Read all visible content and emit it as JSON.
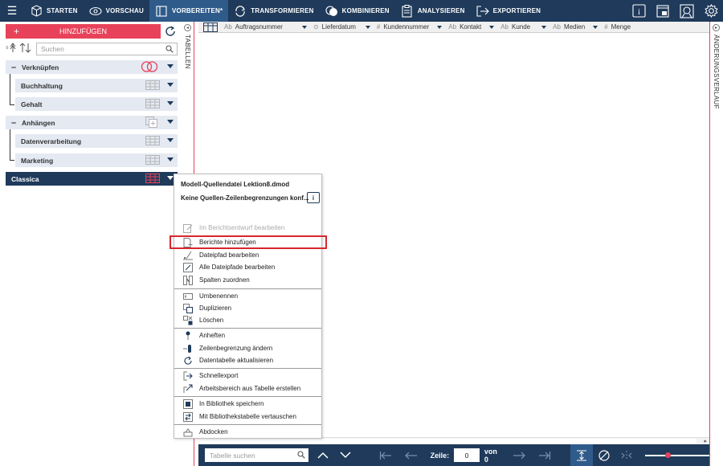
{
  "toolbar": {
    "items": [
      {
        "label": "STARTEN",
        "icon": "cube-icon"
      },
      {
        "label": "VORSCHAU",
        "icon": "eye-icon"
      },
      {
        "label": "VORBEREITEN*",
        "icon": "table-prepare-icon",
        "active": true
      },
      {
        "label": "TRANSFORMIEREN",
        "icon": "transform-icon"
      },
      {
        "label": "KOMBINIEREN",
        "icon": "combine-icon"
      },
      {
        "label": "ANALYSIEREN",
        "icon": "clipboard-icon"
      },
      {
        "label": "EXPORTIEREN",
        "icon": "export-icon"
      }
    ],
    "right_icons": [
      "info-icon",
      "window-icon",
      "help-icon",
      "gear-icon"
    ]
  },
  "left": {
    "add_button": "HINZUFÜGEN",
    "search_placeholder": "Suchen",
    "groups": [
      {
        "label": "Verknüpfen",
        "children": [
          "Buchhaltung",
          "Gehalt"
        ]
      },
      {
        "label": "Anhängen",
        "children": [
          "Datenverarbeitung",
          "Marketing"
        ]
      }
    ],
    "selected": "Classica"
  },
  "tabs": {
    "left": "TABELLEN",
    "right": "ÄNDERUNGSVERLAUF"
  },
  "columns": [
    {
      "type": "Ab",
      "label": "Auftragsnummer"
    },
    {
      "type": "⊙",
      "label": "Lieferdatum"
    },
    {
      "type": "#",
      "label": "Kundennummer"
    },
    {
      "type": "Ab",
      "label": "Kontakt"
    },
    {
      "type": "Ab",
      "label": "Kunde"
    },
    {
      "type": "Ab",
      "label": "Medien"
    },
    {
      "type": "#",
      "label": "Menge"
    }
  ],
  "menu": {
    "title": "Modell-Quellendatei Lektion8.dmod",
    "subtitle": "Keine Quellen-Zeilenbegrenzungen konf...",
    "info": "i",
    "items": {
      "edit_report": "Im Berichtsentwurf bearbeiten",
      "add_reports": "Berichte hinzufügen",
      "edit_path": "Dateipfad bearbeiten",
      "edit_all_paths": "Alle Dateipfade bearbeiten",
      "map_columns": "Spalten zuordnen",
      "rename": "Umbenennen",
      "duplicate": "Duplizieren",
      "delete": "Löschen",
      "pin": "Anheften",
      "change_limit": "Zeilenbegrenzung ändern",
      "refresh_table": "Datentabelle aktualisieren",
      "quick_export": "Schnellexport",
      "workspace_from_table": "Arbeitsbereich aus Tabelle erstellen",
      "save_library": "In Bibliothek speichern",
      "swap_library": "Mit Bibliothekstabelle vertauschen",
      "undock": "Abdocken"
    }
  },
  "bottom": {
    "search_placeholder": "Tabelle suchen",
    "row_label": "Zeile:",
    "row_value": "0",
    "of_label": "von 0",
    "zoom_percent": 35
  },
  "colors": {
    "navy": "#1f3a5a",
    "accent": "#e8425a",
    "highlight": "#d9262e"
  }
}
